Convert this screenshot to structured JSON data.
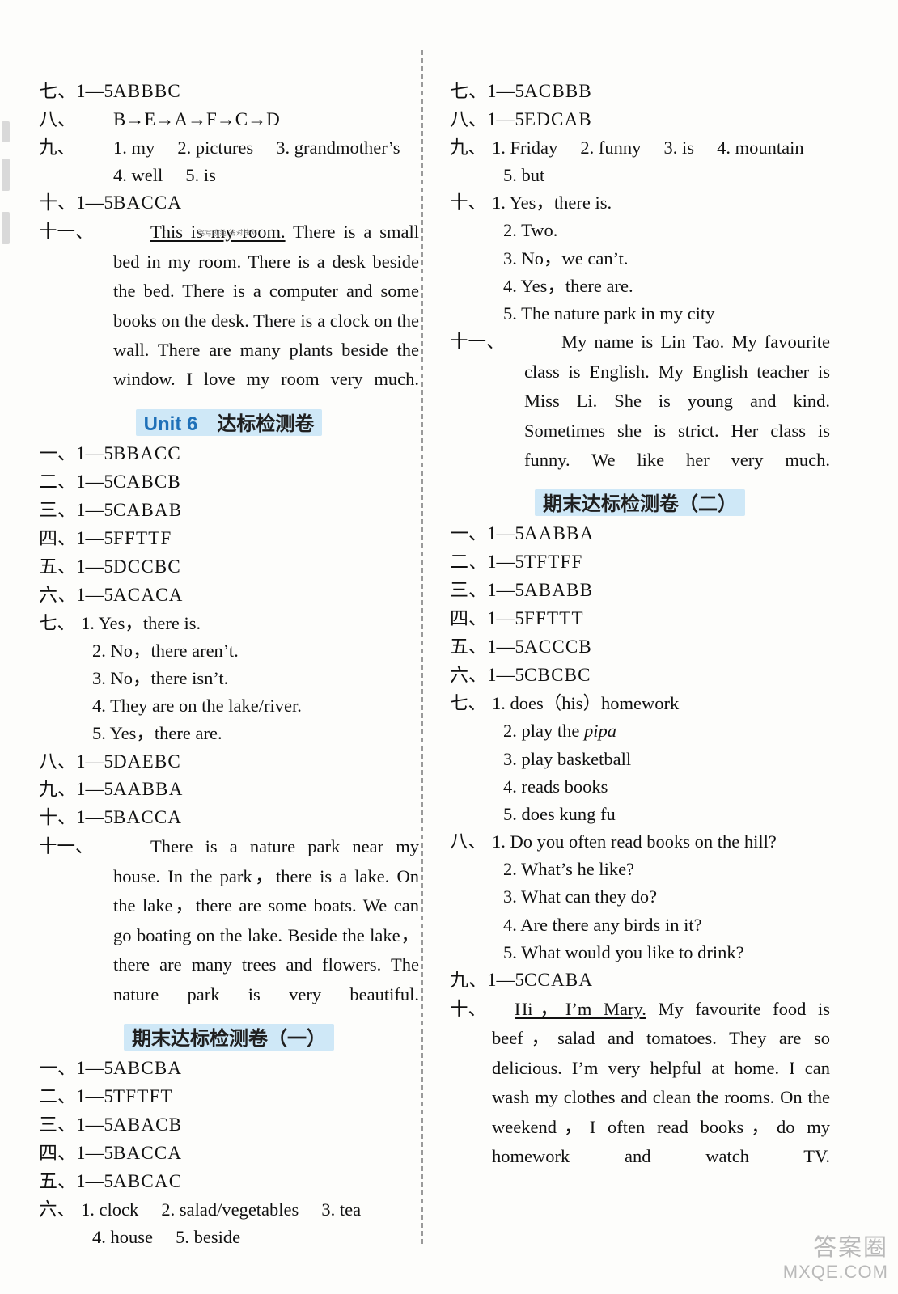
{
  "left_column": {
    "top_answers": [
      {
        "label": "七、1—5",
        "value": "ABBBC"
      },
      {
        "label": "八、",
        "value": "B→E→A→F→C→D"
      }
    ],
    "nine": {
      "label": "九、",
      "line1": "1. my　 2. pictures　 3. grandmother’s",
      "line2": "4. well　 5. is"
    },
    "ten": {
      "label": "十、1—5",
      "value": "BACCA"
    },
    "eleven": {
      "label": "十一、",
      "underlined_start": "This is my room.",
      "text": " There is a small bed in my room.  There is a desk beside the bed.  There is a computer and some books on the desk.  There is a clock on the wall.  There are many plants beside the window.  I love my room very much.",
      "annotation": "书写规范\n答对快对"
    },
    "unit6_heading": {
      "unit": "Unit 6",
      "title": "达标检测卷"
    },
    "unit6_answers": [
      {
        "label": "一、1—5",
        "value": "BBACC"
      },
      {
        "label": "二、1—5",
        "value": "CABCB"
      },
      {
        "label": "三、1—5",
        "value": "CABAB"
      },
      {
        "label": "四、1—5",
        "value": "FFTTF"
      },
      {
        "label": "五、1—5",
        "value": "DCCBC"
      },
      {
        "label": "六、1—5",
        "value": "ACACA"
      }
    ],
    "unit6_seven": {
      "label": "七、",
      "items": [
        "1. Yes，there is.",
        "2. No，there aren’t.",
        "3. No，there isn’t.",
        "4. They are on the lake/river.",
        "5. Yes，there are."
      ]
    },
    "unit6_rest": [
      {
        "label": "八、1—5",
        "value": "DAEBC"
      },
      {
        "label": "九、1—5",
        "value": "AABBA"
      },
      {
        "label": "十、1—5",
        "value": "BACCA"
      }
    ],
    "unit6_eleven": {
      "label": "十一、",
      "text": "There is a nature park near my house.  In the park，there is a lake.  On the lake，there are some boats.  We can go boating on the lake.  Beside the lake，there are many trees and flowers.  The nature park is very beautiful."
    },
    "final1_heading": {
      "title": "期末达标检测卷",
      "num": "（一）"
    },
    "final1_answers": [
      {
        "label": "一、1—5",
        "value": "ABCBA"
      },
      {
        "label": "二、1—5",
        "value": "TFTFT"
      },
      {
        "label": "三、1—5",
        "value": "ABACB"
      },
      {
        "label": "四、1—5",
        "value": "BACCA"
      },
      {
        "label": "五、1—5",
        "value": "ABCAC"
      }
    ],
    "final1_six": {
      "label": "六、",
      "line1": "1. clock　 2. salad/vegetables　 3. tea",
      "line2": "4. house　 5. beside"
    }
  },
  "right_column": {
    "top_answers": [
      {
        "label": "七、1—5",
        "value": "ACBBB"
      },
      {
        "label": "八、1—5",
        "value": "EDCAB"
      }
    ],
    "nine": {
      "label": "九、",
      "line1": "1. Friday　 2. funny　 3. is　 4. mountain",
      "line2": "5. but"
    },
    "ten": {
      "label": "十、",
      "items": [
        "1. Yes，there is.",
        "2. Two.",
        "3. No，we can’t.",
        "4. Yes，there are.",
        "5. The nature park in my city"
      ]
    },
    "eleven": {
      "label": "十一、",
      "text": "My name is Lin Tao.  My favourite class is English.  My English teacher is Miss Li.  She is young and kind.  Sometimes she is strict.  Her class is funny.  We like her very much."
    },
    "final2_heading": {
      "title": "期末达标检测卷",
      "num": "（二）"
    },
    "final2_answers": [
      {
        "label": "一、1—5",
        "value": "AABBA"
      },
      {
        "label": "二、1—5",
        "value": "TFTFF"
      },
      {
        "label": "三、1—5",
        "value": "ABABB"
      },
      {
        "label": "四、1—5",
        "value": "FFTTT"
      },
      {
        "label": "五、1—5",
        "value": "ACCCB"
      },
      {
        "label": "六、1—5",
        "value": "CBCBC"
      }
    ],
    "final2_seven": {
      "label": "七、",
      "items": [
        {
          "text": "1. does（his）homework",
          "italic": ""
        },
        {
          "text": "2. play the ",
          "italic": "pipa"
        },
        {
          "text": "3. play basketball",
          "italic": ""
        },
        {
          "text": "4. reads books",
          "italic": ""
        },
        {
          "text": "5. does kung fu",
          "italic": ""
        }
      ]
    },
    "final2_eight": {
      "label": "八、",
      "items": [
        "1. Do you often read books on the hill?",
        "2. What’s he like?",
        "3. What can they do?",
        "4. Are there any birds in it?",
        "5. What would you like to drink?"
      ]
    },
    "final2_nine": {
      "label": "九、1—5",
      "value": "CCABA"
    },
    "final2_ten": {
      "label": "十、",
      "underlined_start": "Hi，I’m Mary.",
      "text": " My favourite food is beef，salad and tomatoes.  They are so delicious.  I’m very helpful at home.  I can wash my clothes and clean the rooms.  On the weekend，I often read books，do my homework and watch TV."
    }
  },
  "watermark": {
    "cn": "答案圈",
    "en": "MXQE.COM"
  }
}
